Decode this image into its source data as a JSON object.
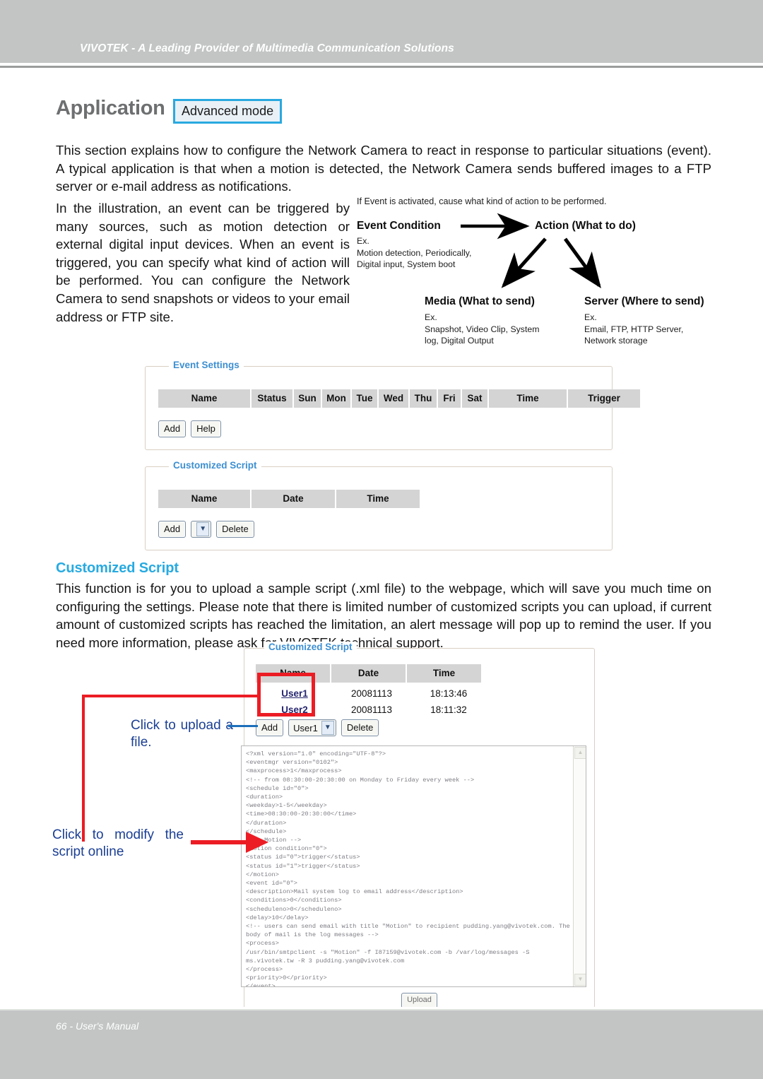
{
  "header": {
    "brand_line": "VIVOTEK - A Leading Provider of Multimedia Communication Solutions",
    "bar_color": "#c3c5c5"
  },
  "page": {
    "title": "Application",
    "mode_badge": "Advanced mode",
    "accent_color": "#29a9e0",
    "intro": "This section explains how to configure the Network Camera to react in response to particular situations (event). A typical application is that when a motion is detected, the Network Camera sends buffered images to a FTP server or e-mail address as notifications.",
    "left_column": "In the illustration, an event can be triggered by many sources, such as motion detection or external digital input devices. When an event is triggered, you can specify what kind of action will be performed. You can configure the Network Camera to send snapshots or videos to your email address or FTP site."
  },
  "diagram": {
    "caption": "If Event is activated, cause what kind of action to be performed.",
    "event_condition_title": "Event Condition",
    "event_condition_ex": "Ex.\nMotion detection, Periodically,\nDigital input, System boot",
    "action_title": "Action (What to do)",
    "media_title": "Media (What to send)",
    "media_ex": "Ex.\nSnapshot, Video Clip, System\nlog, Digital Output",
    "server_title": "Server (Where to send)",
    "server_ex": "Ex.\nEmail, FTP, HTTP Server,\nNetwork storage"
  },
  "event_settings": {
    "legend": "Event Settings",
    "columns": [
      "Name",
      "Status",
      "Sun",
      "Mon",
      "Tue",
      "Wed",
      "Thu",
      "Fri",
      "Sat",
      "Time",
      "Trigger"
    ],
    "add_label": "Add",
    "help_label": "Help"
  },
  "customized_script_empty": {
    "legend": "Customized Script",
    "columns": [
      "Name",
      "Date",
      "Time"
    ],
    "add_label": "Add",
    "delete_label": "Delete",
    "select_value": ""
  },
  "customized_script_section": {
    "heading": "Customized Script",
    "body": "This function is for you to upload a sample script (.xml file) to the webpage, which will save you much time on configuring the settings. Please note that there is limited number of customized scripts you can upload, if current amount of customized scripts has reached the limitation, an alert message will pop up to remind the user. If you need more information, please ask for VIVOTEK technical support."
  },
  "customized_script_filled": {
    "legend": "Customized Script",
    "columns": [
      "Name",
      "Date",
      "Time"
    ],
    "rows": [
      {
        "name": "User1",
        "date": "20081113",
        "time": "18:13:46"
      },
      {
        "name": "User2",
        "date": "20081113",
        "time": "18:11:32"
      }
    ],
    "add_label": "Add",
    "delete_label": "Delete",
    "select_value": "User1",
    "upload_label": "Upload"
  },
  "annotations": {
    "upload_note": "Click to upload a file.",
    "modify_note": "Click to modify the script online",
    "callout_color": "#ec1c24",
    "leader_color": "#1c6fba",
    "text_color": "#1b3f94"
  },
  "script_editor": {
    "content": "<?xml version=\"1.0\" encoding=\"UTF-8\"?>\n<eventmgr version=\"0102\">\n<maxprocess>1</maxprocess>\n<!-- from 08:30:00-20:30:00 on Monday to Friday every week -->\n<schedule id=\"0\">\n<duration>\n<weekday>1-5</weekday>\n<time>08:30:00-20:30:00</time>\n</duration>\n</schedule>\n<!-- Motion -->\n<motion condition=\"0\">\n<status id=\"0\">trigger</status>\n<status id=\"1\">trigger</status>\n</motion>\n<event id=\"0\">\n<description>Mail system log to email address</description>\n<conditions>0</conditions>\n<scheduleno>0</scheduleno>\n<delay>10</delay>\n<!-- users can send email with title \"Motion\" to recipient pudding.yang@vivotek.com. The body of mail is the log messages -->\n<process>\n/usr/bin/smtpclient -s \"Motion\" -f I87159@vivotek.com -b /var/log/messages -S ms.vivotek.tw -R 3 pudding.yang@vivotek.com\n</process>\n<priority>0</priority>\n</event>\n</eventmgr>"
  },
  "footer": {
    "text": "66 - User's Manual"
  }
}
